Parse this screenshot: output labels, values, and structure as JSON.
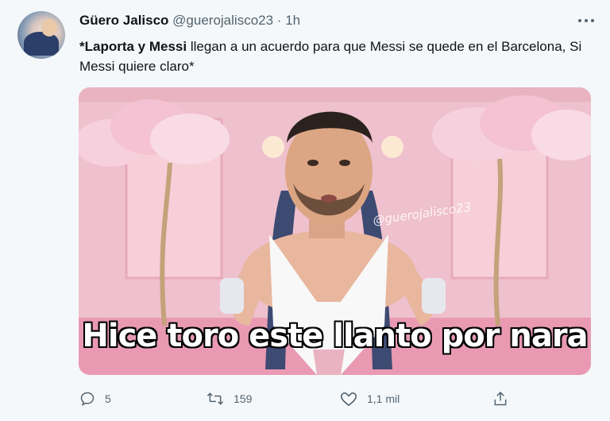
{
  "tweet": {
    "author_name": "Güero Jalisco",
    "handle": "@guerojalisco23",
    "separator": "·",
    "time": "1h",
    "text_bold": "*Laporta y Messi",
    "text_rest": " llegan a un acuerdo para que Messi se quede en el Barcelona, Si Messi quiere claro*"
  },
  "media": {
    "caption": "Hice toro este llanto por nara",
    "watermark": "@guerojalisco23"
  },
  "actions": {
    "replies": "5",
    "retweets": "159",
    "likes": "1,1 mil"
  },
  "icons": {
    "reply": "reply-icon",
    "retweet": "retweet-icon",
    "like": "heart-icon",
    "share": "share-icon",
    "more": "more-icon"
  },
  "colors": {
    "icon_gray": "#536471",
    "text": "#0f1419",
    "background": "#f5f8fa",
    "image_pink": "#f1c3cf"
  }
}
